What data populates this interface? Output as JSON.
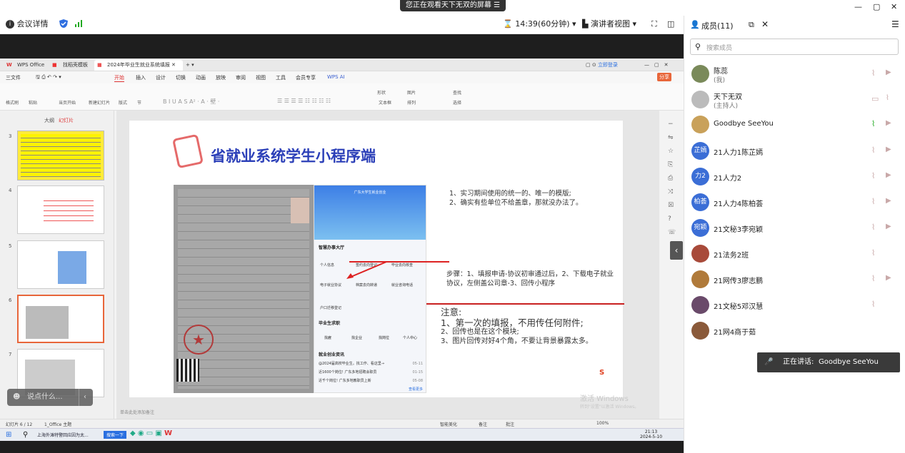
{
  "banner": "您正在观看天下无双的屏幕",
  "toolbar": {
    "details": "会议详情",
    "timer": "14:39(60分钟)",
    "view": "演讲者视图"
  },
  "window_controls": [
    "—",
    "▢",
    "✕"
  ],
  "panel": {
    "title": "成员(11)",
    "search_placeholder": "搜索成员",
    "speaking_label": "正在讲话:",
    "speaking_name": "Goodbye SeeYou"
  },
  "members": [
    {
      "name": "陈蕊",
      "role": "(我)",
      "avatar": "",
      "color": "#7a8a5a",
      "mic": "muted",
      "cam": "off"
    },
    {
      "name": "天下无双",
      "role": "(主持人)",
      "avatar": "",
      "color": "#bbbbbb",
      "mic": "share",
      "cam": "muted"
    },
    {
      "name": "Goodbye SeeYou",
      "role": "",
      "avatar": "",
      "color": "#c9a15a",
      "mic": "on",
      "cam": "off"
    },
    {
      "name": "21人力1陈芷嫣",
      "role": "",
      "avatar": "芷嫣",
      "color": "#3b6ed6",
      "mic": "muted",
      "cam": "off"
    },
    {
      "name": "21人力2",
      "role": "",
      "avatar": "力2",
      "color": "#3b6ed6",
      "mic": "muted",
      "cam": "off"
    },
    {
      "name": "21人力4陈柏荟",
      "role": "",
      "avatar": "柏荟",
      "color": "#3b6ed6",
      "mic": "muted",
      "cam": "off"
    },
    {
      "name": "21文秘3李宛颖",
      "role": "",
      "avatar": "宛颖",
      "color": "#3b6ed6",
      "mic": "muted",
      "cam": "off"
    },
    {
      "name": "21法务2班",
      "role": "",
      "avatar": "",
      "color": "#a84a3a",
      "mic": "muted",
      "cam": ""
    },
    {
      "name": "21网传3廖志鹏",
      "role": "",
      "avatar": "",
      "color": "#b07a3a",
      "mic": "muted",
      "cam": "off"
    },
    {
      "name": "21文秘5邓汉慧",
      "role": "",
      "avatar": "",
      "color": "#6a4a6a",
      "mic": "muted",
      "cam": ""
    },
    {
      "name": "21网4商于茹",
      "role": "",
      "avatar": "",
      "color": "#8a5a3a",
      "mic": "",
      "cam": ""
    }
  ],
  "wps": {
    "tabs": [
      "WPS Office",
      "找稻壳模板",
      "2024年毕业生就业系统填报"
    ],
    "menu": [
      "三文件",
      "开始",
      "插入",
      "设计",
      "切换",
      "动画",
      "放映",
      "审阅",
      "视图",
      "工具",
      "会员专享",
      "WPS AI"
    ],
    "login": "立即登录",
    "share": "分享",
    "ribbon": [
      "格式刷",
      "粘贴",
      "当页开始",
      "新建幻灯片",
      "版式",
      "节",
      "查找",
      "选择",
      "形状",
      "图片",
      "文本框",
      "排列"
    ],
    "thumb_header": [
      "大纲",
      "幻灯片"
    ],
    "slide_numbers": [
      "3",
      "4",
      "5",
      "6",
      "7"
    ],
    "notes_hint": "单击此处添加备注",
    "status": [
      "幻灯片 6 / 12",
      "1_Office 主题",
      "智能美化",
      "备注",
      "批注",
      "100%"
    ],
    "taskbar": [
      "上海外滩特警回应因为太...",
      "搜索一下"
    ],
    "clock": "21:13",
    "date": "2024-5-10",
    "activate": "激活 Windows",
    "activate_sub": "转到\"设置\"以激活 Windows。"
  },
  "slide": {
    "title": "省就业系统学生小程序端",
    "points": [
      "1、实习期间使用的统一的、唯一的模版;",
      "2、确实有些单位不给盖章，那就没办法了。"
    ],
    "steps": "步骤：1、填报申请-协议初审通过后，2、下载电子就业协议，左侧盖公司章-3、回传小程序",
    "note_title": "注意:",
    "notes": [
      "1、第一次的填报，不用传任何附件;",
      "2、回传也是在这个模块;",
      "3、图片回传对好4个角，不要让背景暴露太多。"
    ],
    "phone": {
      "header": "广东大学生就业创业",
      "section1": "智慧办事大厅",
      "items1": [
        "个人信息",
        "签约去向登记",
        "毕业去向核查",
        "电子就业协议",
        "档案去向转递",
        "就业咨询电话",
        "户口迁移登记"
      ],
      "section2": "毕业生求职",
      "items2": [
        "找雇",
        "找企业",
        "找岗位",
        "个人中心"
      ],
      "section3": "就业创业资讯",
      "news": [
        "@2024届高校毕业生。找工作、看这里→",
        "近1600个岗位! 广东多地招聘会职员",
        "近千个岗位! 广东多地教职员上新"
      ],
      "news_dates": [
        "05-11",
        "01-15",
        "05-08"
      ],
      "more": "查看更多"
    }
  },
  "chat": {
    "placeholder": "说点什么..."
  }
}
